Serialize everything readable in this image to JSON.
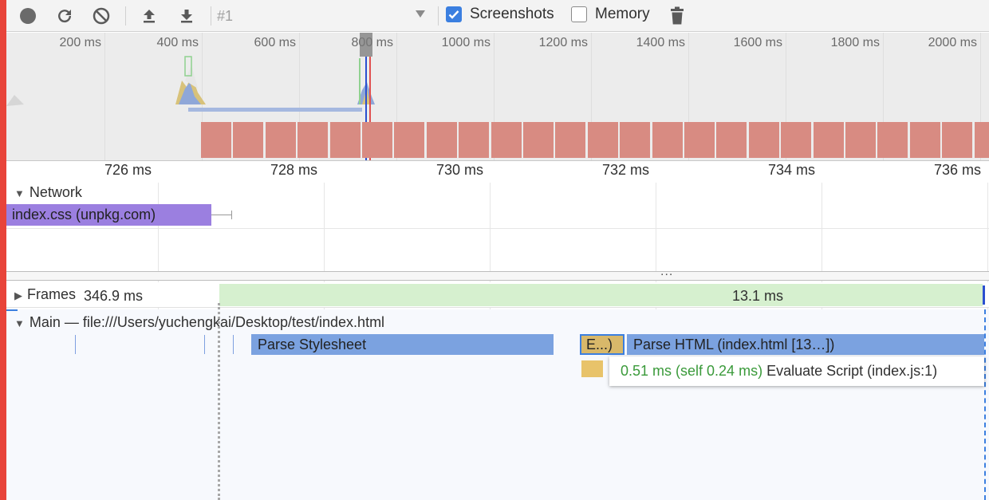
{
  "toolbar": {
    "icons": [
      "record-icon",
      "reload-icon",
      "clear-icon",
      "upload-icon",
      "download-icon"
    ],
    "profile_select": "#1",
    "screenshots_label": "Screenshots",
    "screenshots_checked": true,
    "memory_label": "Memory",
    "memory_checked": false,
    "accent": "#3b7fe0"
  },
  "overview": {
    "ticks": [
      "200 ms",
      "400 ms",
      "600 ms",
      "800 ms",
      "1000 ms",
      "1200 ms",
      "1400 ms",
      "1600 ms",
      "1800 ms",
      "2000 ms"
    ],
    "frame_color": "#d88b82"
  },
  "ruler": {
    "ticks": [
      "726 ms",
      "728 ms",
      "730 ms",
      "732 ms",
      "734 ms",
      "736 ms"
    ]
  },
  "network": {
    "label": "Network",
    "request": "index.css (unpkg.com)",
    "request_color": "#9b7fe0"
  },
  "divider_glyph": "...",
  "frames": {
    "label": "Frames",
    "first_duration": "346.9 ms",
    "second_duration": "13.1 ms"
  },
  "main": {
    "label": "Main — file:///Users/yuchengkai/Desktop/test/index.html",
    "parse_stylesheet": "Parse Stylesheet",
    "evaluate_short": "E...)",
    "parse_html": "Parse HTML (index.html [13…])"
  },
  "tooltip": {
    "timing": "0.51 ms (self 0.24 ms)",
    "title": "Evaluate Script (index.js:1)",
    "timing_color": "#3a9a3a"
  }
}
